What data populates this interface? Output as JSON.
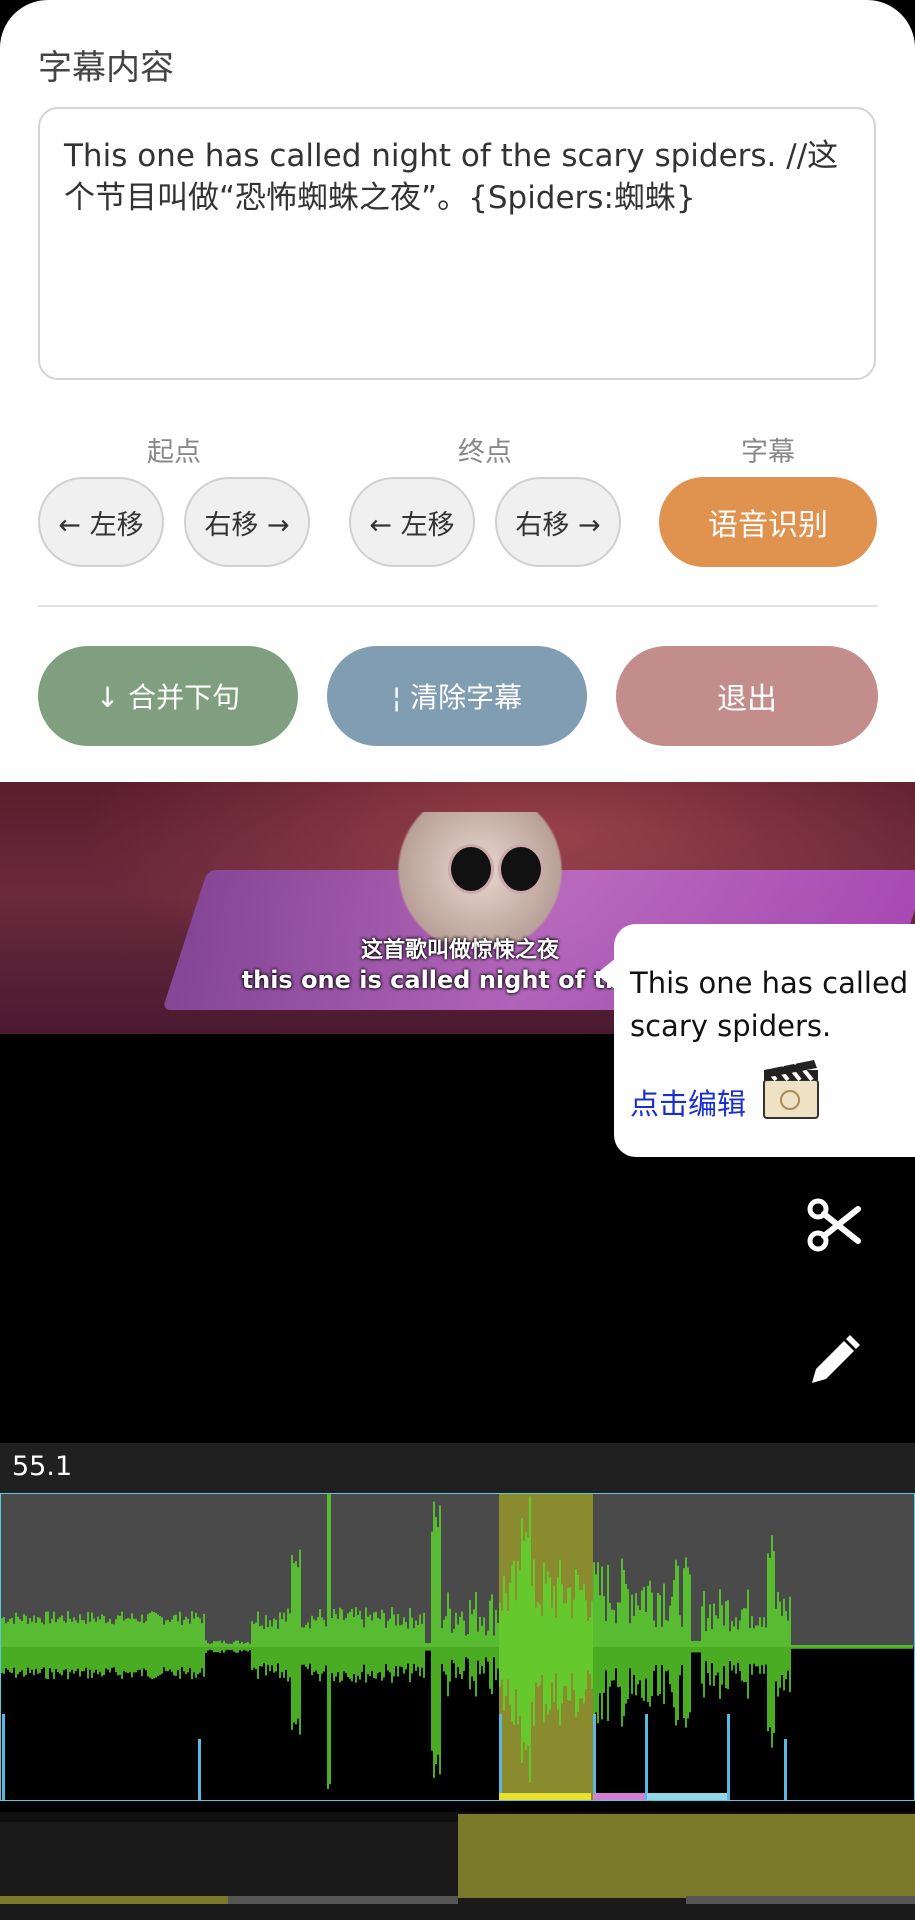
{
  "editor": {
    "section_title": "字幕内容",
    "subtitle_text": "This one has called night of the scary spiders. //这个节目叫做“恐怖蜘蛛之夜”。{Spiders:蜘蛛}",
    "start_group_label": "起点",
    "end_group_label": "终点",
    "subtitle_group_label": "字幕",
    "shift_left_label": "← 左移",
    "shift_right_label": "右移 →",
    "asr_label": "语音识别",
    "merge_label": "↓ 合并下句",
    "clear_label": "¦ 清除字幕",
    "exit_label": "退出"
  },
  "video": {
    "burned_subtitle_cn": "这首歌叫做惊悚之夜",
    "burned_subtitle_en": "this one is called night of the"
  },
  "popup": {
    "text": "This one has called scary spiders.",
    "edit_link": "点击编辑",
    "icon": "clapperboard-icon"
  },
  "tools": {
    "cut_icon": "scissors-icon",
    "edit_icon": "pencil-icon"
  },
  "timeline": {
    "current_time": "55.1",
    "colors": {
      "waveform": "#5cd82c",
      "selection": "#8a8a2e",
      "marker": "#5cb8e0",
      "segment_yellow": "#e8e030",
      "segment_pink": "#d080d0",
      "segment_cyan": "#90d8e8"
    }
  }
}
